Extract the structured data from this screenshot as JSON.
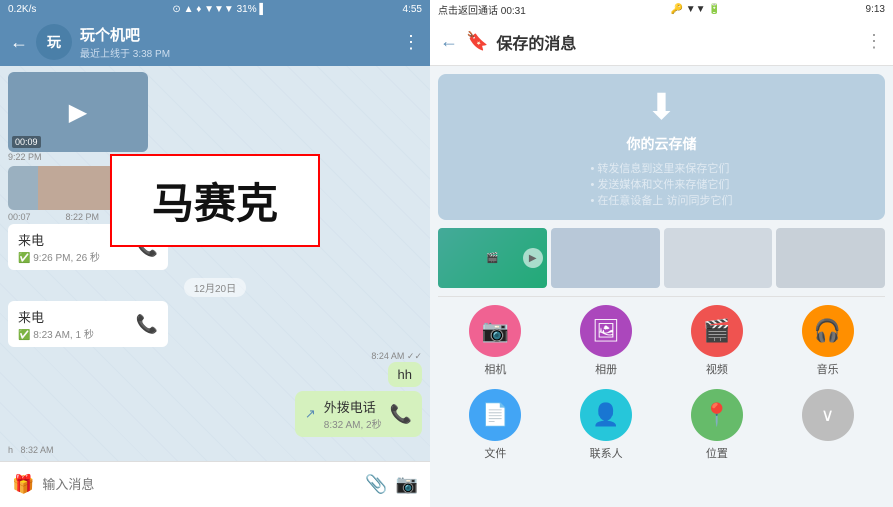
{
  "left": {
    "statusBar": {
      "speed": "0.2K/s",
      "time": "4:55",
      "battery": "31%"
    },
    "header": {
      "back": "←",
      "badge": "玩",
      "name": "玩个机吧",
      "status": "最近上线于 3:38 PM",
      "menu": "⋮"
    },
    "messages": [
      {
        "type": "video",
        "duration": "00:09",
        "time": "9:22 PM"
      },
      {
        "type": "mosaic",
        "text": "马赛克"
      },
      {
        "type": "video2",
        "duration": "00:07",
        "time": "8:22 PM"
      },
      {
        "type": "incoming_call",
        "label": "来电",
        "info": "9:26 PM, 26 秒",
        "date_divider": null
      },
      {
        "type": "date_divider",
        "text": "12月20日"
      },
      {
        "type": "incoming_call2",
        "label": "来电",
        "info": "8:23 AM, 1 秒"
      },
      {
        "type": "sent_text",
        "text": "hh",
        "time": "8:24 AM",
        "status": "✓✓"
      },
      {
        "type": "sent_call",
        "label": "外拨电话",
        "info": "8:32 AM, 2秒"
      }
    ],
    "bottomBar": {
      "placeholder": "输入消息",
      "attachIcon": "📎",
      "cameraIcon": "🎁"
    },
    "bottomTime": "h  8:32 AM"
  },
  "right": {
    "statusBar": {
      "left": "点击返回通话 00:31",
      "time": "9:13"
    },
    "header": {
      "back": "←",
      "bookmark": "🔖",
      "title": "保存的消息",
      "menu": "⋮"
    },
    "cloudCard": {
      "icon": "⬇",
      "title": "你的云存储",
      "features": [
        "转发信息到这里来保存它们",
        "发送媒体和文件来存储它们",
        "在任意设备上 访问同步它们"
      ]
    },
    "thumbnails": [
      {
        "type": "video",
        "label": "video"
      },
      {
        "type": "doc",
        "label": "doc"
      },
      {
        "type": "doc2",
        "label": "doc2"
      },
      {
        "type": "doc3",
        "label": "doc3"
      }
    ],
    "mediaGrid": [
      {
        "icon": "📷",
        "label": "相机",
        "color": "mc-camera"
      },
      {
        "icon": "🖼",
        "label": "相册",
        "color": "mc-photo"
      },
      {
        "icon": "🎬",
        "label": "视频",
        "color": "mc-video"
      },
      {
        "icon": "🎧",
        "label": "音乐",
        "color": "mc-music"
      },
      {
        "icon": "📄",
        "label": "文件",
        "color": "mc-file"
      },
      {
        "icon": "👤",
        "label": "联系人",
        "color": "mc-contact"
      },
      {
        "icon": "📍",
        "label": "位置",
        "color": "mc-location"
      },
      {
        "icon": "∨",
        "label": "",
        "color": "mc-more"
      }
    ]
  }
}
